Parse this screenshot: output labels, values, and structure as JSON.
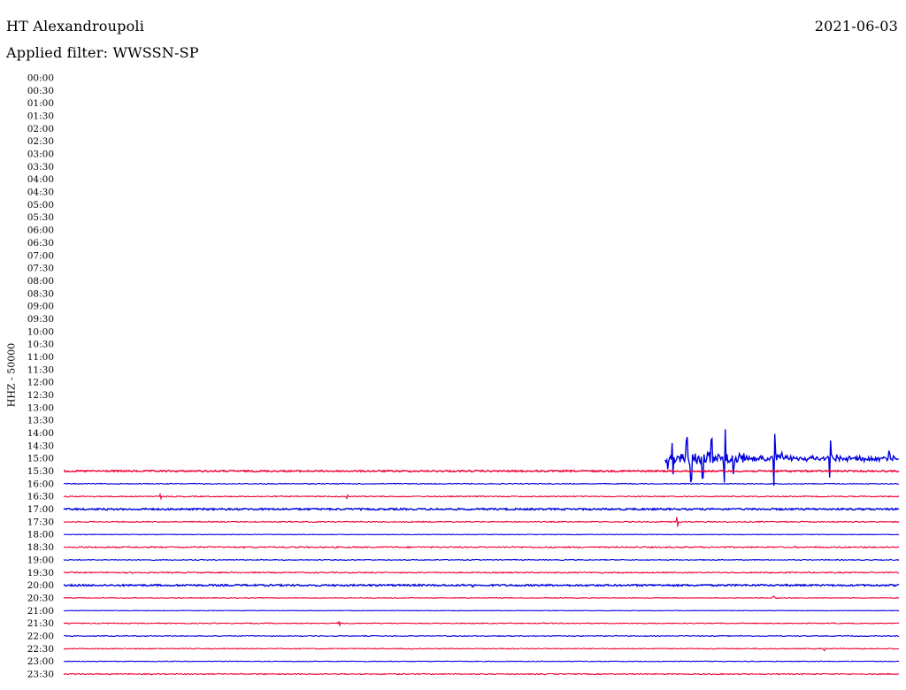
{
  "header": {
    "station": "HT Alexandroupoli",
    "date": "2021-06-03",
    "filter": "Applied filter: WWSSN-SP"
  },
  "chart_data": {
    "type": "line",
    "title": "HT Alexandroupoli",
    "ylabel": "HHZ - 50000",
    "row_minutes": 30,
    "time_labels": [
      "00:00",
      "00:30",
      "01:00",
      "01:30",
      "02:00",
      "02:30",
      "03:00",
      "03:30",
      "04:00",
      "04:30",
      "05:00",
      "05:30",
      "06:00",
      "06:30",
      "07:00",
      "07:30",
      "08:00",
      "08:30",
      "09:00",
      "09:30",
      "10:00",
      "10:30",
      "11:00",
      "11:30",
      "12:00",
      "12:30",
      "13:00",
      "13:30",
      "14:00",
      "14:30",
      "15:00",
      "15:30",
      "16:00",
      "16:30",
      "17:00",
      "17:30",
      "18:00",
      "18:30",
      "19:00",
      "19:30",
      "20:00",
      "20:30",
      "21:00",
      "21:30",
      "22:00",
      "22:30",
      "23:00",
      "23:30"
    ],
    "colors": {
      "even": "#0000dd",
      "odd": "#ee0033"
    },
    "traces": [
      {
        "label": "15:00",
        "start_fraction": 0.72,
        "noise": 2,
        "events": [
          {
            "t": 0.004,
            "amp": 8
          },
          {
            "t": 0.009,
            "amp": 14
          },
          {
            "t": 0.026,
            "amp": 22
          },
          {
            "t": 0.031,
            "amp": 26
          },
          {
            "t": 0.045,
            "amp": 24
          },
          {
            "t": 0.056,
            "amp": 20
          },
          {
            "t": 0.072,
            "amp": 30
          },
          {
            "t": 0.082,
            "amp": 12
          },
          {
            "t": 0.131,
            "amp": 28
          },
          {
            "t": 0.139,
            "amp": 6
          },
          {
            "t": 0.198,
            "amp": 22
          },
          {
            "t": 0.205,
            "amp": 4
          },
          {
            "t": 0.269,
            "amp": 8
          }
        ]
      },
      {
        "label": "15:30",
        "start_fraction": 0,
        "noise": 0.9,
        "events": []
      },
      {
        "label": "16:00",
        "start_fraction": 0,
        "noise": 0.5,
        "events": []
      },
      {
        "label": "16:30",
        "start_fraction": 0,
        "noise": 0.6,
        "events": [
          {
            "t": 0.116,
            "amp": 3
          },
          {
            "t": 0.339,
            "amp": 2
          }
        ]
      },
      {
        "label": "17:00",
        "start_fraction": 0,
        "noise": 1.0,
        "events": []
      },
      {
        "label": "17:30",
        "start_fraction": 0,
        "noise": 0.6,
        "events": [
          {
            "t": 0.735,
            "amp": 6
          }
        ]
      },
      {
        "label": "18:00",
        "start_fraction": 0,
        "noise": 0.3,
        "events": []
      },
      {
        "label": "18:30",
        "start_fraction": 0,
        "noise": 0.8,
        "events": []
      },
      {
        "label": "19:00",
        "start_fraction": 0,
        "noise": 0.5,
        "events": []
      },
      {
        "label": "19:30",
        "start_fraction": 0,
        "noise": 0.7,
        "events": []
      },
      {
        "label": "20:00",
        "start_fraction": 0,
        "noise": 1.0,
        "events": [
          {
            "t": 0.49,
            "amp": 2.5
          }
        ]
      },
      {
        "label": "20:30",
        "start_fraction": 0,
        "noise": 0.4,
        "events": [
          {
            "t": 0.85,
            "amp": 2
          }
        ]
      },
      {
        "label": "21:00",
        "start_fraction": 0,
        "noise": 0.3,
        "events": []
      },
      {
        "label": "21:30",
        "start_fraction": 0,
        "noise": 0.5,
        "events": [
          {
            "t": 0.33,
            "amp": 2
          }
        ]
      },
      {
        "label": "22:00",
        "start_fraction": 0,
        "noise": 0.5,
        "events": []
      },
      {
        "label": "22:30",
        "start_fraction": 0,
        "noise": 0.5,
        "events": [
          {
            "t": 0.91,
            "amp": 2
          }
        ]
      },
      {
        "label": "23:00",
        "start_fraction": 0,
        "noise": 0.4,
        "events": []
      },
      {
        "label": "23:30",
        "start_fraction": 0,
        "noise": 0.6,
        "events": []
      }
    ]
  }
}
